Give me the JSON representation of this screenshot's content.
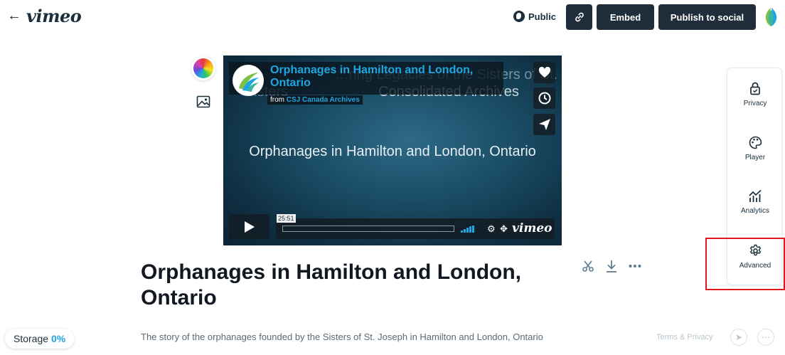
{
  "header": {
    "back_icon": "arrow-left-icon",
    "logo": "vimeo",
    "privacy_status": "Public",
    "embed_label": "Embed",
    "publish_label": "Publish to social"
  },
  "player": {
    "overlay_title": "Orphanages in Hamilton and London, Ontario",
    "overlay_from_prefix": "from",
    "overlay_from_channel": "CSJ Canada Archives",
    "ghost_text_1": "…ring Legacies of the Sisters of St.",
    "ghost_text_2": "Consolidated Archives",
    "video_main_title": "Orphanages in Hamilton and London, Ontario",
    "time_badge": "25:51",
    "logo": "vimeo"
  },
  "video": {
    "title": "Orphanages in Hamilton and London, Ontario",
    "description": "The story of the orphanages founded by the Sisters of St. Joseph in Hamilton and London, Ontario"
  },
  "side_panel": {
    "items": [
      {
        "label": "Privacy",
        "icon": "lock-icon"
      },
      {
        "label": "Player",
        "icon": "palette-icon"
      },
      {
        "label": "Analytics",
        "icon": "analytics-icon"
      },
      {
        "label": "Advanced",
        "icon": "gear-icon"
      }
    ]
  },
  "footer": {
    "storage_label": "Storage",
    "storage_value": "0%",
    "terms": "Terms & Privacy"
  },
  "colors": {
    "accent": "#1fa6e0",
    "dark_button": "#1f2e3a",
    "highlight": "#e0181e"
  }
}
